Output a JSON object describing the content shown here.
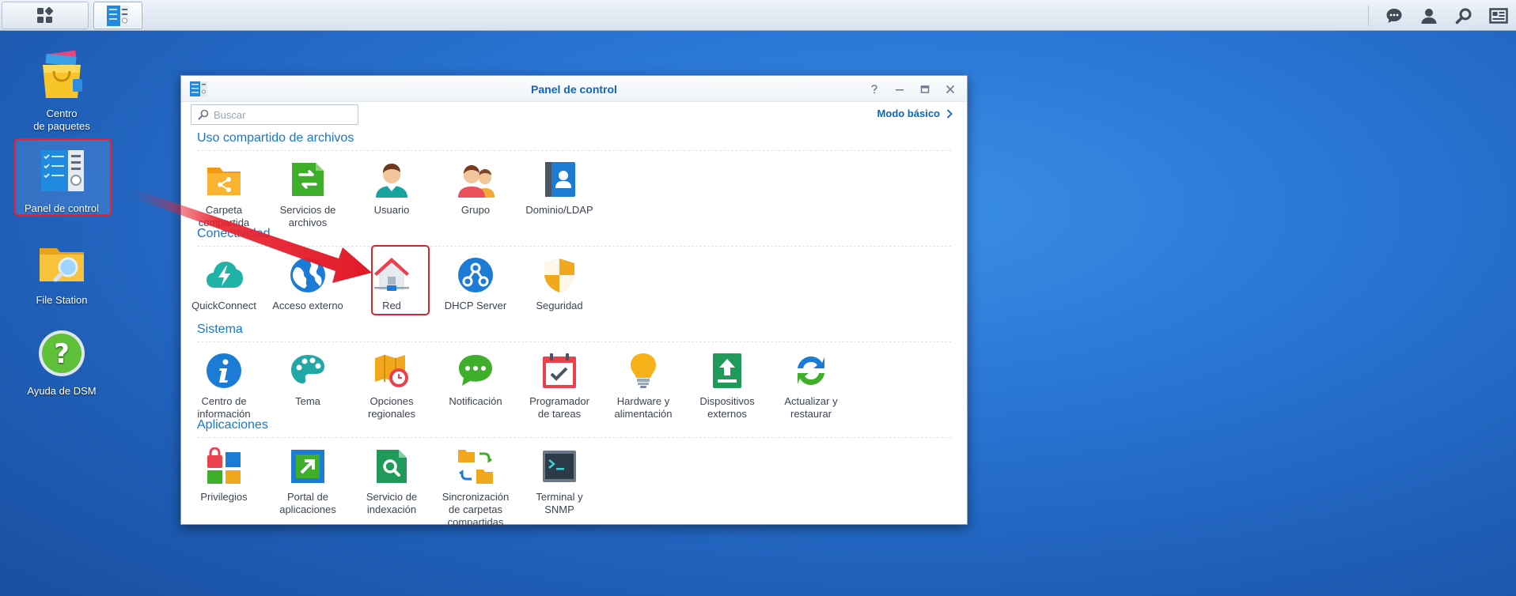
{
  "taskbar": {
    "main_menu_icon": "grid-menu-icon",
    "active_app_icon": "control-panel-icon",
    "right_icons": [
      "chat-icon",
      "user-icon",
      "search-icon",
      "widgets-icon"
    ]
  },
  "desktop": {
    "icons": [
      {
        "label": "Centro\nde paquetes",
        "icon": "package-center-icon"
      },
      {
        "label": "Panel de control",
        "icon": "control-panel-icon"
      },
      {
        "label": "File Station",
        "icon": "file-station-icon"
      },
      {
        "label": "Ayuda de DSM",
        "icon": "help-icon"
      }
    ]
  },
  "window": {
    "title": "Panel de control",
    "search": {
      "placeholder": "Buscar",
      "value": ""
    },
    "mode_link": "Modo básico",
    "sections": [
      {
        "title": "Uso compartido de archivos",
        "items": [
          {
            "label": "Carpeta\ncompartida",
            "icon": "shared-folder-icon"
          },
          {
            "label": "Servicios de\narchivos",
            "icon": "file-services-icon"
          },
          {
            "label": "Usuario",
            "icon": "user-icon"
          },
          {
            "label": "Grupo",
            "icon": "group-icon"
          },
          {
            "label": "Dominio/LDAP",
            "icon": "domain-ldap-icon"
          }
        ]
      },
      {
        "title": "Conectividad",
        "items": [
          {
            "label": "QuickConnect",
            "icon": "quickconnect-icon"
          },
          {
            "label": "Acceso externo",
            "icon": "external-access-icon"
          },
          {
            "label": "Red",
            "icon": "network-icon"
          },
          {
            "label": "DHCP Server",
            "icon": "dhcp-server-icon"
          },
          {
            "label": "Seguridad",
            "icon": "security-icon"
          }
        ]
      },
      {
        "title": "Sistema",
        "items": [
          {
            "label": "Centro de\ninformación",
            "icon": "info-center-icon"
          },
          {
            "label": "Tema",
            "icon": "theme-icon"
          },
          {
            "label": "Opciones\nregionales",
            "icon": "regional-options-icon"
          },
          {
            "label": "Notificación",
            "icon": "notification-icon"
          },
          {
            "label": "Programador\nde tareas",
            "icon": "task-scheduler-icon"
          },
          {
            "label": "Hardware y\nalimentación",
            "icon": "hardware-power-icon"
          },
          {
            "label": "Dispositivos\nexternos",
            "icon": "external-devices-icon"
          },
          {
            "label": "Actualizar y\nrestaurar",
            "icon": "update-restore-icon"
          }
        ]
      },
      {
        "title": "Aplicaciones",
        "items": [
          {
            "label": "Privilegios",
            "icon": "privileges-icon"
          },
          {
            "label": "Portal de\naplicaciones",
            "icon": "application-portal-icon"
          },
          {
            "label": "Servicio de\nindexación",
            "icon": "indexing-service-icon"
          },
          {
            "label": "Sincronización\nde carpetas\ncompartidas",
            "icon": "shared-folder-sync-icon"
          },
          {
            "label": "Terminal y\nSNMP",
            "icon": "terminal-snmp-icon"
          }
        ]
      }
    ]
  },
  "colors": {
    "accent": "#1676d2",
    "highlight": "#e0202e",
    "desktop": "#2a76d6"
  }
}
